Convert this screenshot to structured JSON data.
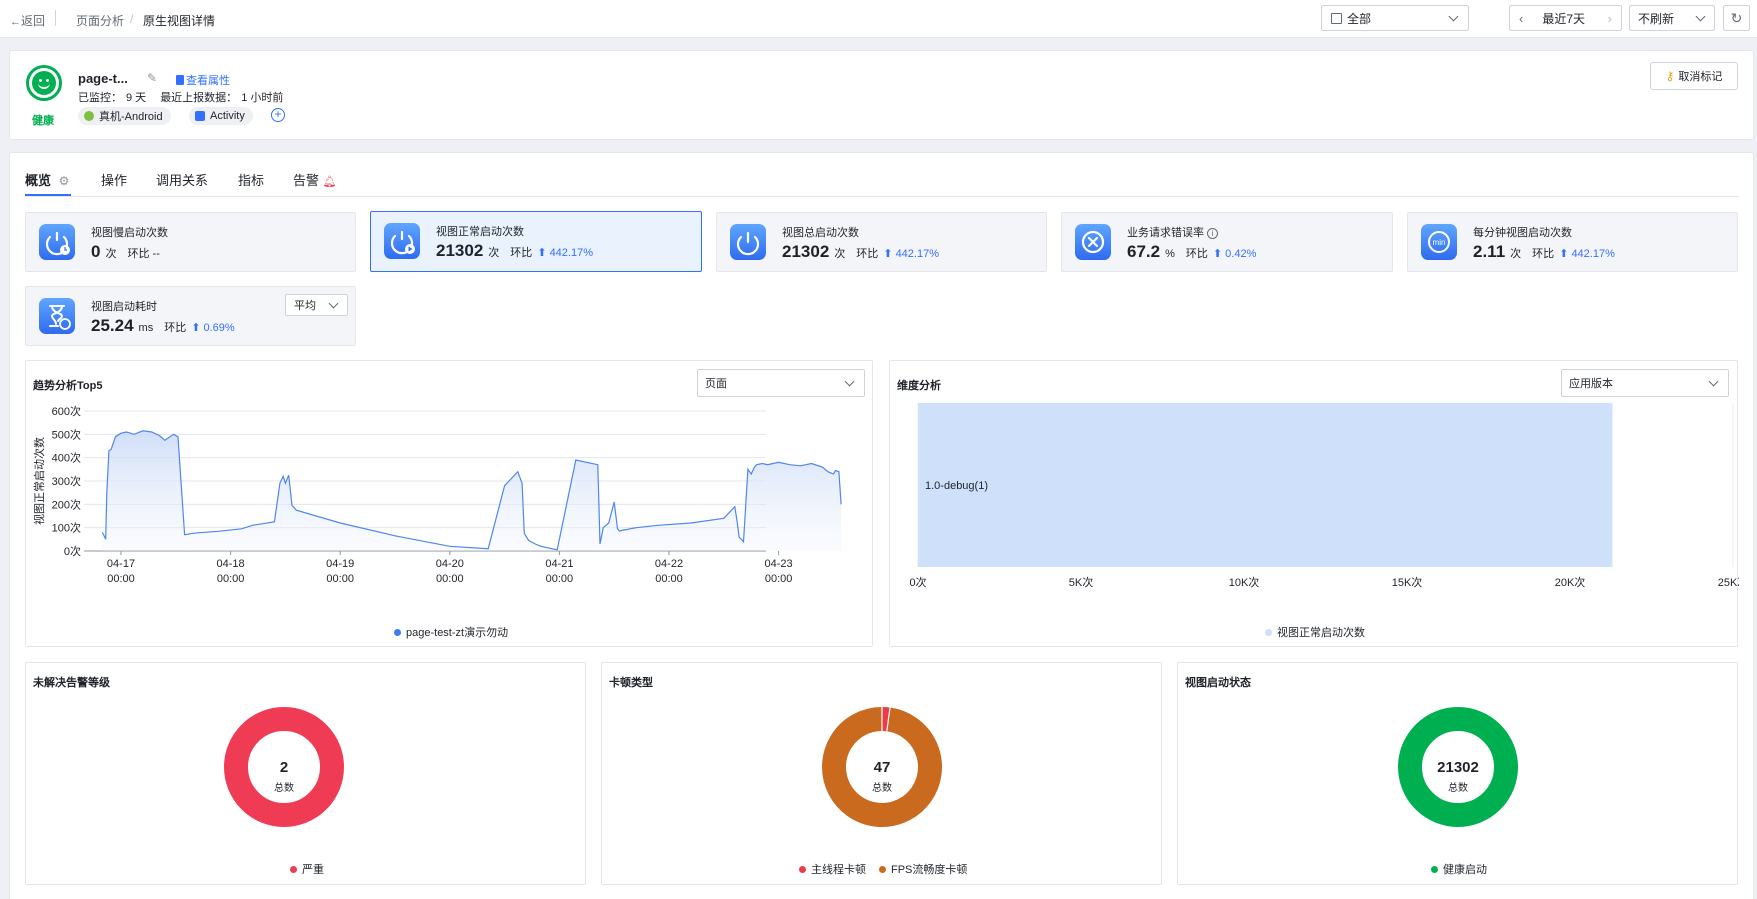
{
  "topbar": {
    "back": "返回",
    "breadcrumb": [
      "页面分析",
      "/",
      "原生视图详情"
    ],
    "app_select": "全部",
    "range": "最近7天",
    "refresh": "不刷新"
  },
  "header": {
    "health_label": "健康",
    "name": "page-t...",
    "view_attrs": "查看属性",
    "monitored_label": "已监控：",
    "monitored_value": "9 天",
    "last_report_label": "最近上报数据：",
    "last_report_value": "1 小时前",
    "tags": [
      "真机-Android",
      "Activity"
    ],
    "unmark": "取消标记"
  },
  "tabs": [
    "概览",
    "操作",
    "调用关系",
    "指标",
    "告警"
  ],
  "metrics": [
    {
      "label": "视图慢启动次数",
      "value": "0",
      "unit": "次",
      "hb": "环比 --",
      "pct": ""
    },
    {
      "label": "视图正常启动次数",
      "value": "21302",
      "unit": "次",
      "hb": "环比",
      "pct": "442.17%"
    },
    {
      "label": "视图总启动次数",
      "value": "21302",
      "unit": "次",
      "hb": "环比",
      "pct": "442.17%"
    },
    {
      "label": "业务请求错误率",
      "value": "67.2",
      "unit": "%",
      "hb": "环比",
      "pct": "0.42%"
    },
    {
      "label": "每分钟视图启动次数",
      "value": "2.11",
      "unit": "次",
      "hb": "环比",
      "pct": "442.17%"
    },
    {
      "label": "视图启动耗时",
      "value": "25.24",
      "unit": "ms",
      "hb": "环比",
      "pct": "0.69%",
      "select": "平均"
    }
  ],
  "trend": {
    "title": "趋势分析Top5",
    "select": "页面",
    "icon_min": "min"
  },
  "dimension": {
    "title": "维度分析",
    "select": "应用版本"
  },
  "donuts": [
    {
      "title": "未解决告警等级",
      "total": "2",
      "total_label": "总数",
      "legend": [
        "严重"
      ]
    },
    {
      "title": "卡顿类型",
      "total": "47",
      "total_label": "总数",
      "legend": [
        "主线程卡顿",
        "FPS流畅度卡顿"
      ]
    },
    {
      "title": "视图启动状态",
      "total": "21302",
      "total_label": "总数",
      "legend": [
        "健康启动"
      ]
    }
  ],
  "colors": {
    "accent": "#3370ff",
    "health": "#00b050",
    "severe": "#f03b55",
    "fps": "#c96a1f",
    "main_thread": "#ee3b4b",
    "bar": "#cfe0fb"
  },
  "chart_data": [
    {
      "type": "area",
      "title": "趋势分析Top5",
      "ylabel": "视图正常启动次数",
      "x_ticks": [
        "04-17 00:00",
        "04-18 00:00",
        "04-19 00:00",
        "04-20 00:00",
        "04-21 00:00",
        "04-22 00:00",
        "04-23 00:00"
      ],
      "y_ticks": [
        "0次",
        "100次",
        "200次",
        "300次",
        "400次",
        "500次",
        "600次"
      ],
      "ylim": [
        0,
        600
      ],
      "series": [
        {
          "name": "page-test-zt演示勿动",
          "x": [
            -0.17,
            -0.14,
            -0.13,
            -0.11,
            -0.09,
            -0.05,
            0.0,
            0.05,
            0.12,
            0.2,
            0.28,
            0.35,
            0.4,
            0.48,
            0.52,
            0.58,
            0.61,
            0.62,
            0.63,
            0.7,
            0.9,
            1.1,
            1.2,
            1.4,
            1.45,
            1.48,
            1.5,
            1.53,
            1.56,
            1.58,
            1.6,
            2.0,
            2.5,
            3.0,
            3.35,
            3.5,
            3.62,
            3.66,
            3.68,
            3.7,
            3.72,
            3.78,
            3.83,
            3.98,
            4.15,
            4.35,
            4.37,
            4.4,
            4.45,
            4.5,
            4.53,
            4.55,
            4.58,
            4.62,
            4.65,
            4.7,
            4.9,
            5.2,
            5.5,
            5.6,
            5.62,
            5.64,
            5.68,
            5.72,
            5.75,
            5.78,
            5.8,
            5.85,
            5.9,
            6.0,
            6.1,
            6.2,
            6.3,
            6.4,
            6.45,
            6.5,
            6.52,
            6.55,
            6.57
          ],
          "values": [
            80,
            50,
            250,
            430,
            435,
            490,
            505,
            510,
            500,
            515,
            510,
            495,
            475,
            500,
            490,
            70,
            72,
            73,
            74,
            78,
            85,
            95,
            110,
            125,
            290,
            320,
            290,
            325,
            195,
            185,
            175,
            120,
            65,
            20,
            10,
            280,
            340,
            290,
            75,
            60,
            45,
            30,
            20,
            5,
            390,
            370,
            30,
            100,
            120,
            210,
            95,
            85,
            90,
            92,
            96,
            100,
            110,
            120,
            140,
            190,
            130,
            60,
            40,
            350,
            330,
            360,
            370,
            375,
            370,
            380,
            370,
            365,
            375,
            360,
            340,
            330,
            345,
            340,
            200
          ]
        }
      ]
    },
    {
      "type": "bar",
      "title": "维度分析",
      "orientation": "horizontal",
      "categories": [
        "1.0-debug(1)"
      ],
      "series": [
        {
          "name": "视图正常启动次数",
          "values": [
            21302
          ]
        }
      ],
      "x_ticks": [
        "0次",
        "5K次",
        "10K次",
        "15K次",
        "20K次",
        "25K次"
      ],
      "xlim": [
        0,
        25000
      ]
    },
    {
      "type": "pie",
      "title": "未解决告警等级",
      "categories": [
        "严重"
      ],
      "values": [
        2
      ]
    },
    {
      "type": "pie",
      "title": "卡顿类型",
      "categories": [
        "主线程卡顿",
        "FPS流畅度卡顿"
      ],
      "values": [
        1,
        46
      ]
    },
    {
      "type": "pie",
      "title": "视图启动状态",
      "categories": [
        "健康启动"
      ],
      "values": [
        21302
      ]
    }
  ]
}
